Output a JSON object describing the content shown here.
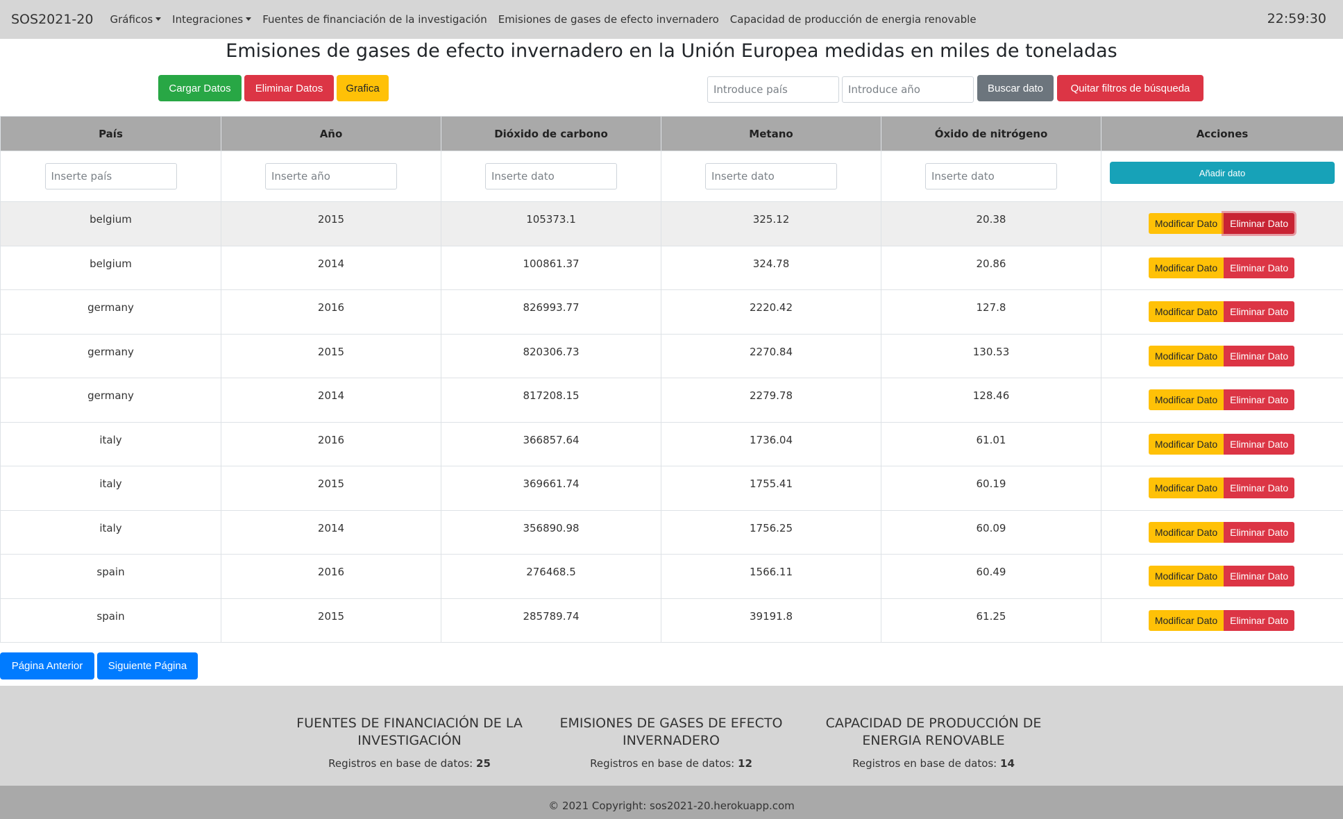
{
  "navbar": {
    "brand": "SOS2021-20",
    "menu_graficos": "Gráficos",
    "menu_integraciones": "Integraciones",
    "link_fuentes": "Fuentes de financiación de la investigación",
    "link_emisiones": "Emisiones de gases de efecto invernadero",
    "link_capacidad": "Capacidad de producción de energia renovable",
    "clock": "22:59:30"
  },
  "title": "Emisiones de gases de efecto invernadero en la Unión Europea medidas en miles de toneladas",
  "toolbar": {
    "cargar": "Cargar Datos",
    "eliminar": "Eliminar Datos",
    "grafica": "Grafica",
    "search_country_placeholder": "Introduce país",
    "search_year_placeholder": "Introduce año",
    "buscar": "Buscar dato",
    "quitar": "Quitar filtros de búsqueda"
  },
  "table": {
    "headers": [
      "País",
      "Año",
      "Dióxido de carbono",
      "Metano",
      "Óxido de nitrógeno",
      "Acciones"
    ],
    "input_placeholders": [
      "Inserte país",
      "Inserte año",
      "Inserte dato",
      "Inserte dato",
      "Inserte dato"
    ],
    "add_label": "Añadir dato",
    "modify_label": "Modificar Dato",
    "delete_label": "Eliminar Dato",
    "rows": [
      [
        "belgium",
        "2015",
        "105373.1",
        "325.12",
        "20.38"
      ],
      [
        "belgium",
        "2014",
        "100861.37",
        "324.78",
        "20.86"
      ],
      [
        "germany",
        "2016",
        "826993.77",
        "2220.42",
        "127.8"
      ],
      [
        "germany",
        "2015",
        "820306.73",
        "2270.84",
        "130.53"
      ],
      [
        "germany",
        "2014",
        "817208.15",
        "2279.78",
        "128.46"
      ],
      [
        "italy",
        "2016",
        "366857.64",
        "1736.04",
        "61.01"
      ],
      [
        "italy",
        "2015",
        "369661.74",
        "1755.41",
        "60.19"
      ],
      [
        "italy",
        "2014",
        "356890.98",
        "1756.25",
        "60.09"
      ],
      [
        "spain",
        "2016",
        "276468.5",
        "1566.11",
        "60.49"
      ],
      [
        "spain",
        "2015",
        "285789.74",
        "39191.8",
        "61.25"
      ]
    ]
  },
  "pagination": {
    "prev": "Página Anterior",
    "next": "Siguiente Página"
  },
  "summary": [
    {
      "title_line1": "FUENTES DE FINANCIACIÓN DE LA",
      "title_line2": "INVESTIGACIÓN",
      "count_label": "Registros en base de datos:",
      "count": "25"
    },
    {
      "title_line1": "EMISIONES DE GASES DE EFECTO",
      "title_line2": "INVERNADERO",
      "count_label": "Registros en base de datos:",
      "count": "12"
    },
    {
      "title_line1": "CAPACIDAD DE PRODUCCIÓN DE",
      "title_line2": "ENERGIA RENOVABLE",
      "count_label": "Registros en base de datos:",
      "count": "14"
    }
  ],
  "copyright": "© 2021 Copyright: sos2021-20.herokuapp.com",
  "colors": {
    "success": "#28a745",
    "danger": "#dc3545",
    "warning": "#ffc107",
    "secondary": "#6c757d",
    "primary": "#007bff",
    "info": "#17a2b8"
  }
}
